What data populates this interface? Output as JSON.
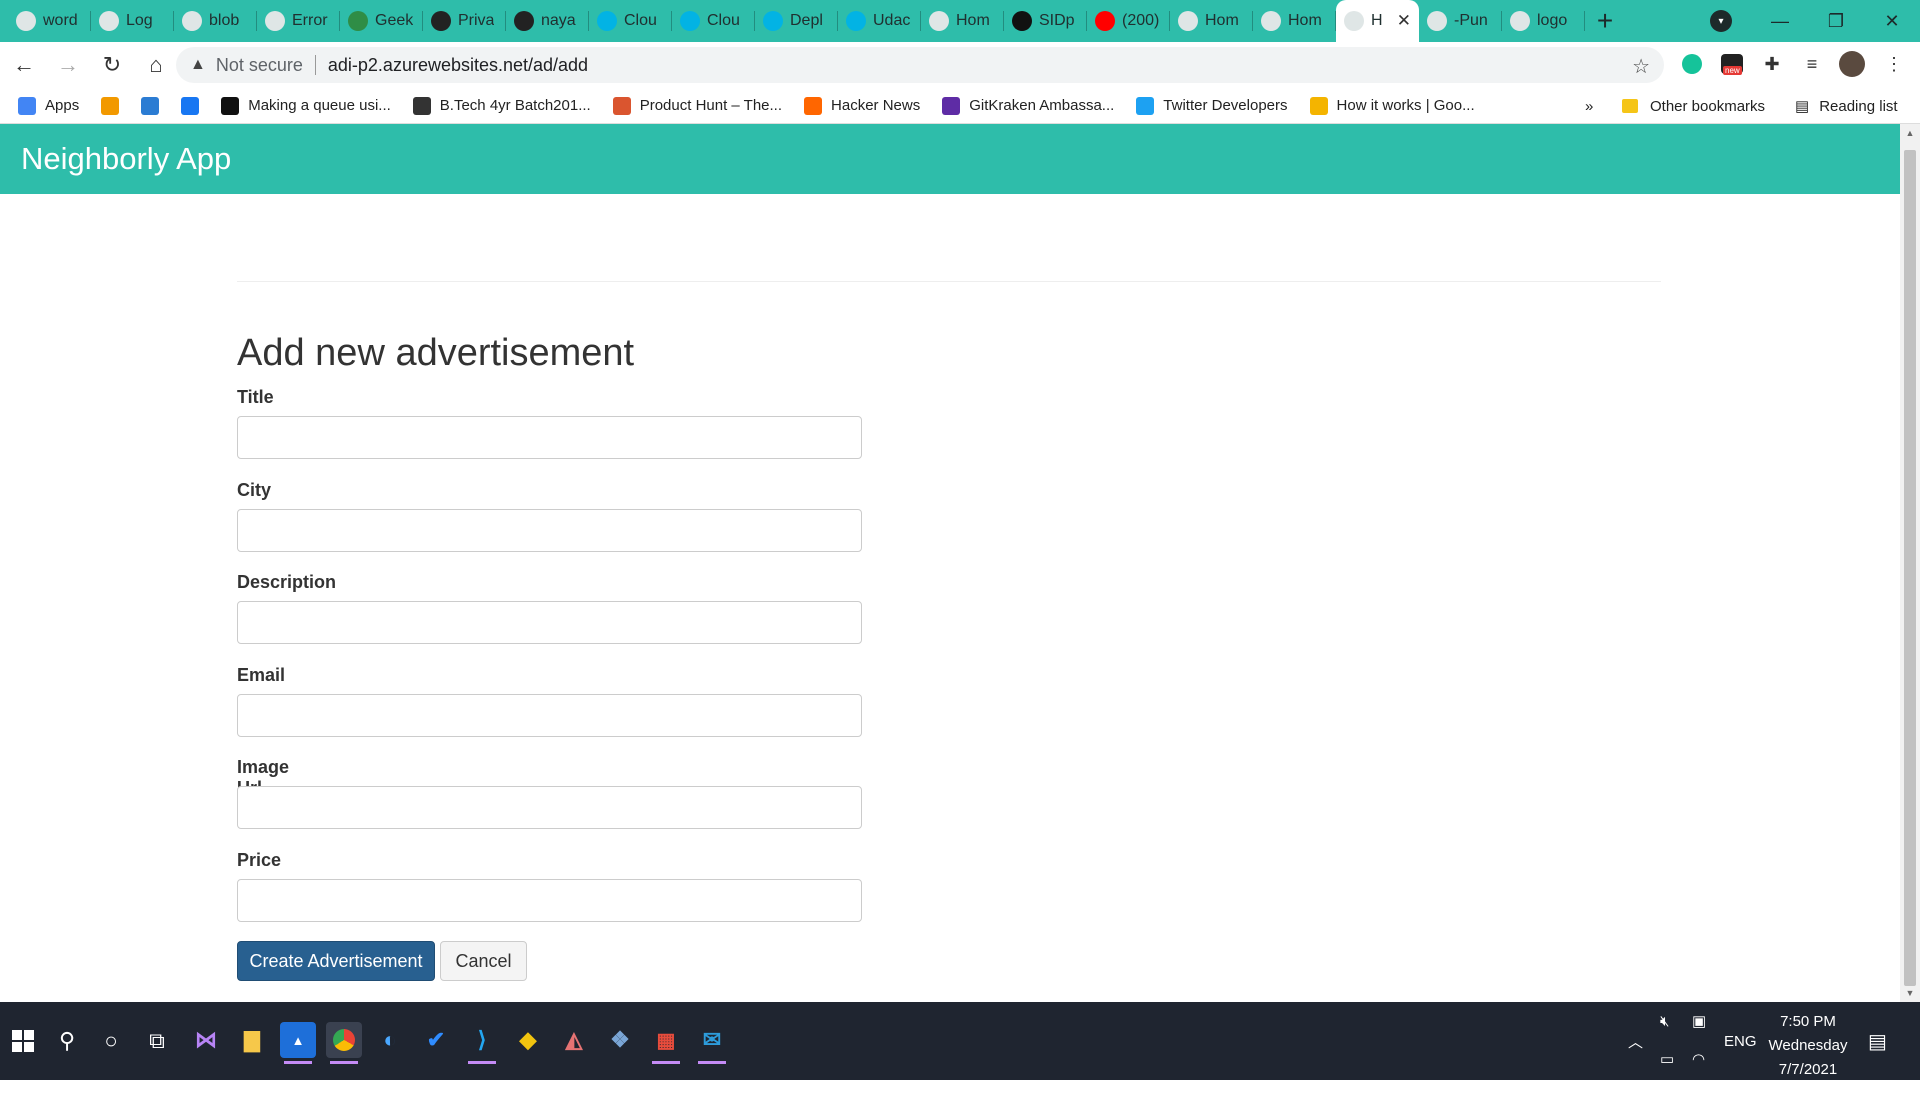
{
  "browser": {
    "tabs": [
      {
        "label": "word",
        "icon": "google-icon",
        "color": "#ffffff"
      },
      {
        "label": "Log",
        "icon": "peace-icon",
        "color": "#ffffff"
      },
      {
        "label": "blob",
        "icon": "globe-icon",
        "color": "#ffffff"
      },
      {
        "label": "Error",
        "icon": "code-icon",
        "color": "#ffffff"
      },
      {
        "label": "Geek",
        "icon": "gfg-icon",
        "color": "#2f8d46"
      },
      {
        "label": "Priva",
        "icon": "gear-icon",
        "color": "#222222"
      },
      {
        "label": "naya",
        "icon": "github-icon",
        "color": "#222222"
      },
      {
        "label": "Clou",
        "icon": "udacity-icon",
        "color": "#02b3e4"
      },
      {
        "label": "Clou",
        "icon": "udacity-icon",
        "color": "#02b3e4"
      },
      {
        "label": "Depl",
        "icon": "udacity-icon",
        "color": "#02b3e4"
      },
      {
        "label": "Udac",
        "icon": "udacity-icon",
        "color": "#02b3e4"
      },
      {
        "label": "Hom",
        "icon": "globe-icon",
        "color": "#ffffff"
      },
      {
        "label": "SIDp",
        "icon": "info-icon",
        "color": "#111111"
      },
      {
        "label": "(200)",
        "icon": "youtube-icon",
        "color": "#ff0000"
      },
      {
        "label": "Hom",
        "icon": "globe-icon",
        "color": "#ffffff"
      },
      {
        "label": "Hom",
        "icon": "globe-icon",
        "color": "#ffffff"
      },
      {
        "label": "H",
        "icon": "globe-icon",
        "color": "#ffffff",
        "active": true
      },
      {
        "label": "-Pun",
        "icon": "doc-icon",
        "color": "#ffffff"
      },
      {
        "label": "logo",
        "icon": "doc-icon",
        "color": "#ffffff"
      }
    ],
    "new_tab_label": "+",
    "security_label": "Not secure",
    "url": "adi-p2.azurewebsites.net/ad/add",
    "bookmarks": [
      {
        "label": "Apps",
        "icon": "apps-grid-icon",
        "color": "#4285f4"
      },
      {
        "label": "",
        "icon": "chart-icon",
        "color": "#f29900"
      },
      {
        "label": "",
        "icon": "w-icon",
        "color": "#2b7cd3"
      },
      {
        "label": "",
        "icon": "facebook-icon",
        "color": "#1877f2"
      },
      {
        "label": "Making a queue usi...",
        "icon": "media-icon",
        "color": "#111111"
      },
      {
        "label": "B.Tech 4yr Batch201...",
        "icon": "globe-icon",
        "color": "#333333"
      },
      {
        "label": "Product Hunt – The...",
        "icon": "producthunt-icon",
        "color": "#da552f"
      },
      {
        "label": "Hacker News",
        "icon": "ycombinator-icon",
        "color": "#ff6600"
      },
      {
        "label": "GitKraken Ambassa...",
        "icon": "list-icon",
        "color": "#5e2ca5"
      },
      {
        "label": "Twitter Developers",
        "icon": "twitter-icon",
        "color": "#1da1f2"
      },
      {
        "label": "How it works | Goo...",
        "icon": "sun-icon",
        "color": "#f4b400"
      }
    ],
    "overflow_label": "»",
    "other_bookmarks": "Other bookmarks",
    "reading_list": "Reading list"
  },
  "page": {
    "brand": "Neighborly App",
    "title": "Add new advertisement",
    "fields": [
      {
        "label": "Title",
        "value": ""
      },
      {
        "label": "City",
        "value": ""
      },
      {
        "label": "Description",
        "value": ""
      },
      {
        "label": "Email",
        "value": ""
      },
      {
        "label": "Image Url",
        "value": ""
      },
      {
        "label": "Price",
        "value": ""
      }
    ],
    "submit_label": "Create Advertisement",
    "cancel_label": "Cancel",
    "colors": {
      "navbar": "#2ebdaa",
      "primary": "#286090"
    }
  },
  "taskbar": {
    "language": "ENG",
    "time": "7:50 PM",
    "day": "Wednesday",
    "date": "7/7/2021"
  }
}
